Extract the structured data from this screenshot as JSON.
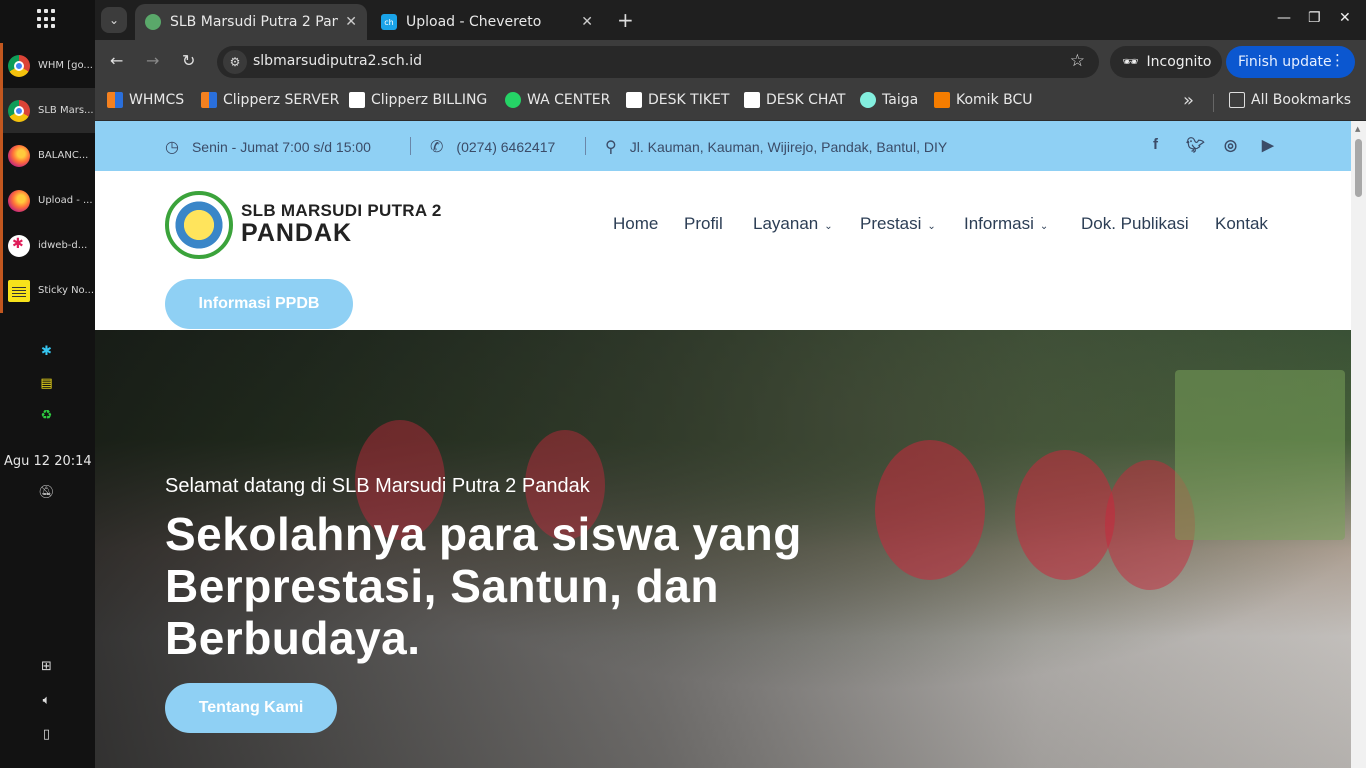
{
  "os": {
    "taskbar_items": [
      {
        "label": "WHM [go...",
        "icon": "chrome-icon"
      },
      {
        "label": "SLB Mars...",
        "icon": "chrome-icon"
      },
      {
        "label": "BALANC...",
        "icon": "firefox-icon"
      },
      {
        "label": "Upload - ...",
        "icon": "firefox-icon"
      },
      {
        "label": "idweb-d...",
        "icon": "slack-icon"
      },
      {
        "label": "Sticky No...",
        "icon": "sticky-notes-icon"
      }
    ],
    "clock": "Agu 12  20:14"
  },
  "browser": {
    "tabs": [
      {
        "title": "SLB Marsudi Putra 2 Pan",
        "active": true
      },
      {
        "title": "Upload - Chevereto",
        "active": false
      }
    ],
    "url": "slbmarsudiputra2.sch.id",
    "incognito_label": "Incognito",
    "update_label": "Finish update",
    "bookmarks": [
      {
        "label": "WHMCS",
        "color": "#f48120"
      },
      {
        "label": "Clipperz SERVER",
        "color": "#f48120"
      },
      {
        "label": "Clipperz BILLING",
        "color": "#ffffff"
      },
      {
        "label": "WA CENTER",
        "color": "#25d366"
      },
      {
        "label": "DESK TIKET",
        "color": "#ffffff"
      },
      {
        "label": "DESK CHAT",
        "color": "#ffffff"
      },
      {
        "label": "Taiga",
        "color": "#83eede"
      },
      {
        "label": "Komik BCU",
        "color": "#f57d00"
      }
    ],
    "all_bookmarks_label": "All Bookmarks"
  },
  "site": {
    "topbar": {
      "hours": "Senin - Jumat 7:00 s/d 15:00",
      "phone": "(0274) 6462417",
      "address": "Jl. Kauman, Kauman, Wijirejo, Pandak, Bantul, DIY"
    },
    "logo": {
      "line1": "SLB MARSUDI PUTRA 2",
      "line2": "PANDAK"
    },
    "nav": [
      {
        "label": "Home"
      },
      {
        "label": "Profil"
      },
      {
        "label": "Layanan"
      },
      {
        "label": "Prestasi"
      },
      {
        "label": "Informasi"
      },
      {
        "label": "Dok. Publikasi"
      },
      {
        "label": "Kontak"
      }
    ],
    "ppdb_button": "Informasi PPDB",
    "hero": {
      "welcome": "Selamat datang di SLB Marsudi Putra 2 Pandak",
      "title": "Sekolahnya para siswa yang Berprestasi, Santun, dan Berbudaya.",
      "button": "Tentang Kami"
    },
    "accent_color": "#8fd0f4"
  }
}
